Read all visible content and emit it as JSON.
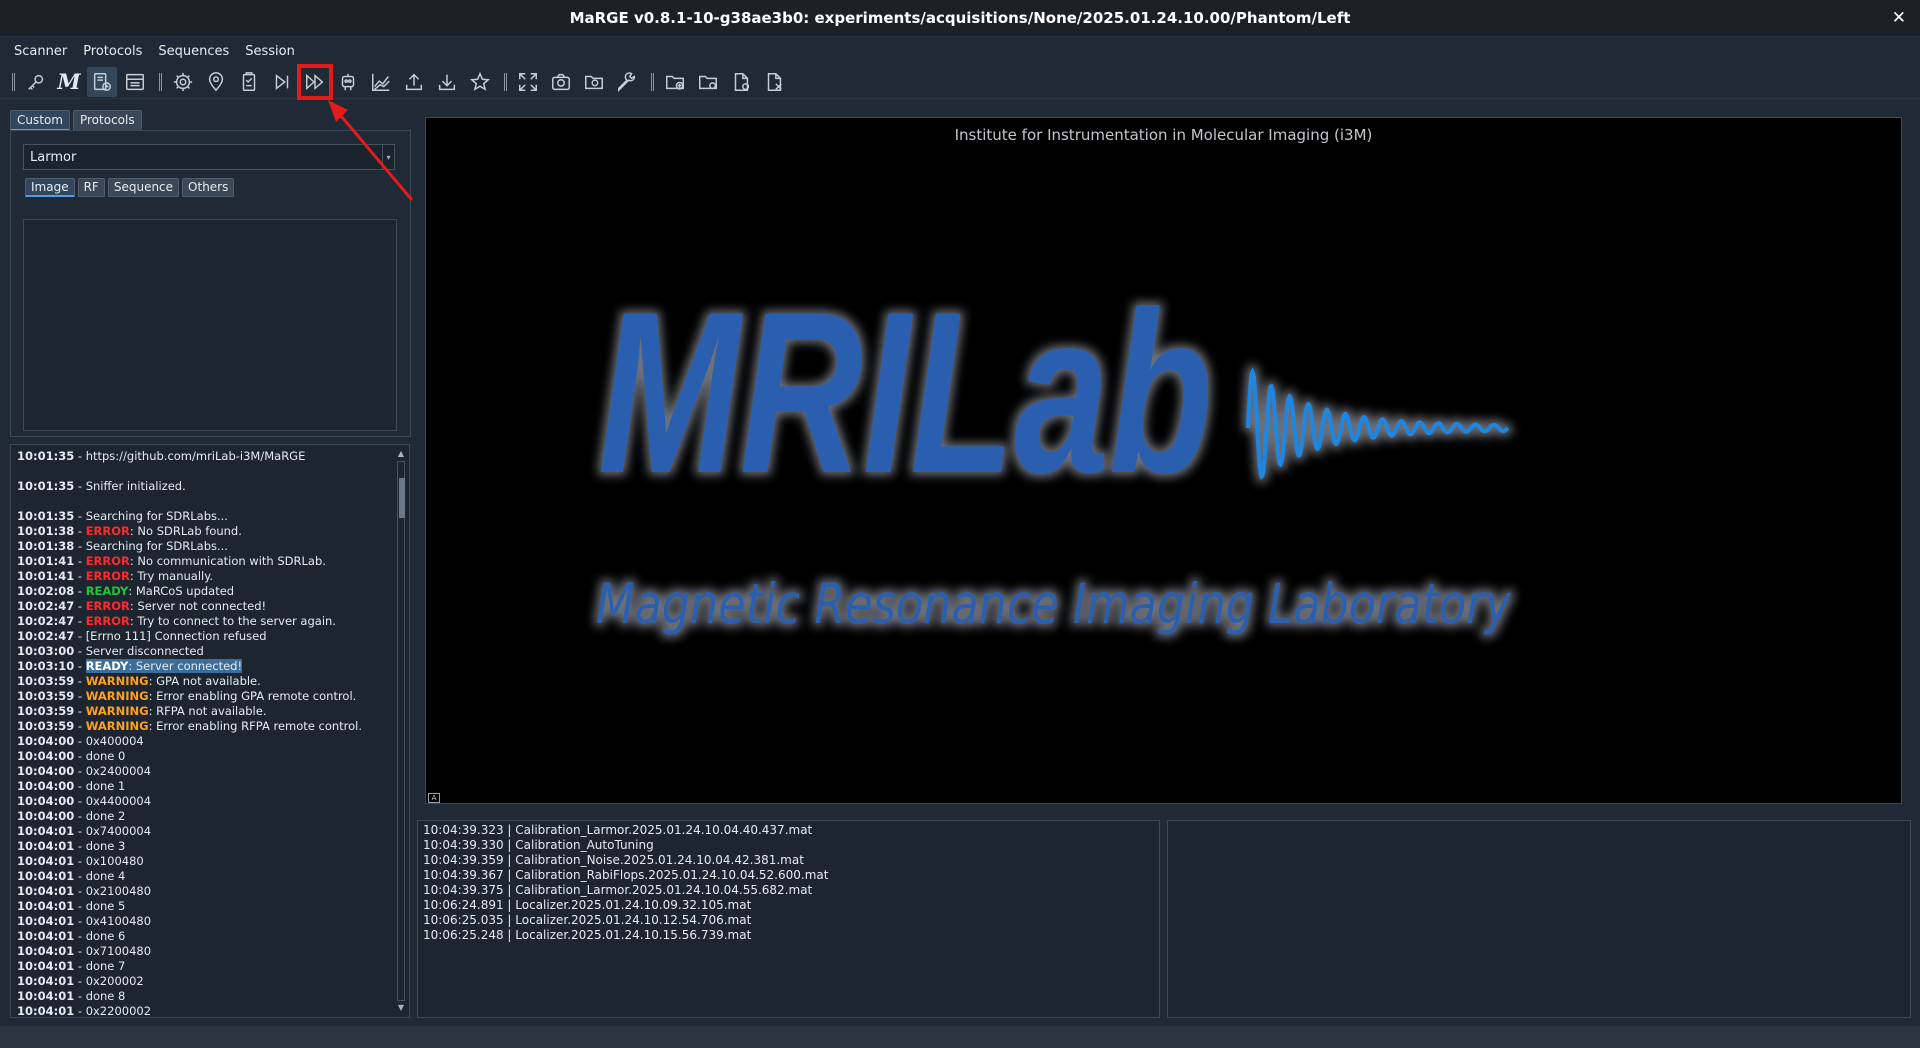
{
  "window": {
    "title": "MaRGE v0.8.1-10-g38ae3b0: experiments/acquisitions/None/2025.01.24.10.00/Phantom/Left"
  },
  "menu": {
    "items": [
      "Scanner",
      "Protocols",
      "Sequences",
      "Session"
    ]
  },
  "toolbar": {
    "icons": [
      "key-icon",
      "marcos-m-icon",
      "sdrlab-icon",
      "gpa-icon",
      "settings-icon",
      "localizer-icon",
      "clipboard-icon",
      "run-icon",
      "fast-forward-icon",
      "robot-icon",
      "plot-icon",
      "upload-icon",
      "download-icon",
      "star-icon",
      "fullscreen-icon",
      "camera-icon",
      "camera-folder-icon",
      "wrench-icon",
      "folder-add-icon",
      "folder-settings-icon",
      "file-settings-icon",
      "file-close-icon"
    ],
    "highlighted": "fast-forward-icon"
  },
  "left": {
    "tabs": [
      "Custom",
      "Protocols"
    ],
    "sequence_select": "Larmor",
    "inner_tabs": [
      "Image",
      "RF",
      "Sequence",
      "Others"
    ]
  },
  "console": {
    "lines": [
      {
        "ts": "10:01:35",
        "level": "",
        "msg": "https://github.com/mriLab-i3M/MaRGE"
      },
      {
        "ts": "10:01:35",
        "level": "",
        "msg": "Sniffer initialized."
      },
      {
        "ts": "10:01:35",
        "level": "",
        "msg": "Searching for SDRLabs..."
      },
      {
        "ts": "10:01:38",
        "level": "ERROR",
        "msg": "No SDRLab found."
      },
      {
        "ts": "10:01:38",
        "level": "",
        "msg": "Searching for SDRLabs..."
      },
      {
        "ts": "10:01:41",
        "level": "ERROR",
        "msg": "No communication with SDRLab."
      },
      {
        "ts": "10:01:41",
        "level": "ERROR",
        "msg": "Try manually."
      },
      {
        "ts": "10:02:08",
        "level": "READY",
        "msg": "MaRCoS updated"
      },
      {
        "ts": "10:02:47",
        "level": "ERROR",
        "msg": "Server not connected!"
      },
      {
        "ts": "10:02:47",
        "level": "ERROR",
        "msg": "Try to connect to the server again."
      },
      {
        "ts": "10:02:47",
        "level": "",
        "msg": "[Errno 111] Connection refused"
      },
      {
        "ts": "10:03:00",
        "level": "",
        "msg": "Server disconnected"
      },
      {
        "ts": "10:03:10",
        "level": "READY",
        "msg": "Server connected!"
      },
      {
        "ts": "10:03:59",
        "level": "WARNING",
        "msg": "GPA not available."
      },
      {
        "ts": "10:03:59",
        "level": "WARNING",
        "msg": "Error enabling GPA remote control."
      },
      {
        "ts": "10:03:59",
        "level": "WARNING",
        "msg": "RFPA not available."
      },
      {
        "ts": "10:03:59",
        "level": "WARNING",
        "msg": "Error enabling RFPA remote control."
      },
      {
        "ts": "10:04:00",
        "level": "",
        "msg": "0x400004"
      },
      {
        "ts": "10:04:00",
        "level": "",
        "msg": "done 0"
      },
      {
        "ts": "10:04:00",
        "level": "",
        "msg": "0x2400004"
      },
      {
        "ts": "10:04:00",
        "level": "",
        "msg": "done 1"
      },
      {
        "ts": "10:04:00",
        "level": "",
        "msg": "0x4400004"
      },
      {
        "ts": "10:04:00",
        "level": "",
        "msg": "done 2"
      },
      {
        "ts": "10:04:01",
        "level": "",
        "msg": "0x7400004"
      },
      {
        "ts": "10:04:01",
        "level": "",
        "msg": "done 3"
      },
      {
        "ts": "10:04:01",
        "level": "",
        "msg": "0x100480"
      },
      {
        "ts": "10:04:01",
        "level": "",
        "msg": "done 4"
      },
      {
        "ts": "10:04:01",
        "level": "",
        "msg": "0x2100480"
      },
      {
        "ts": "10:04:01",
        "level": "",
        "msg": "done 5"
      },
      {
        "ts": "10:04:01",
        "level": "",
        "msg": "0x4100480"
      },
      {
        "ts": "10:04:01",
        "level": "",
        "msg": "done 6"
      },
      {
        "ts": "10:04:01",
        "level": "",
        "msg": "0x7100480"
      },
      {
        "ts": "10:04:01",
        "level": "",
        "msg": "done 7"
      },
      {
        "ts": "10:04:01",
        "level": "",
        "msg": "0x200002"
      },
      {
        "ts": "10:04:01",
        "level": "",
        "msg": "done 8"
      },
      {
        "ts": "10:04:01",
        "level": "",
        "msg": "0x2200002"
      }
    ]
  },
  "viewer": {
    "title": "Institute for Instrumentation in Molecular Imaging (i3M)",
    "logo_main": "MRILab",
    "logo_sub": "Magnetic Resonance Imaging Laboratory",
    "corner_label": "A"
  },
  "history": {
    "items": [
      "10:04:39.323 | Calibration_Larmor.2025.01.24.10.04.40.437.mat",
      "10:04:39.330 | Calibration_AutoTuning",
      "10:04:39.359 | Calibration_Noise.2025.01.24.10.04.42.381.mat",
      "10:04:39.367 | Calibration_RabiFlops.2025.01.24.10.04.52.600.mat",
      "10:04:39.375 | Calibration_Larmor.2025.01.24.10.04.55.682.mat",
      "10:06:24.891 | Localizer.2025.01.24.10.09.32.105.mat",
      "10:06:25.035 | Localizer.2025.01.24.10.12.54.706.mat",
      "10:06:25.248 | Localizer.2025.01.24.10.15.56.739.mat"
    ]
  },
  "colors": {
    "logo_blue": "#2b5fb0",
    "wave_blue": "#1d86e0",
    "error": "#ff2b2b",
    "ready": "#23c53b",
    "warning": "#ffa11a",
    "highlight": "#e21b1b"
  }
}
